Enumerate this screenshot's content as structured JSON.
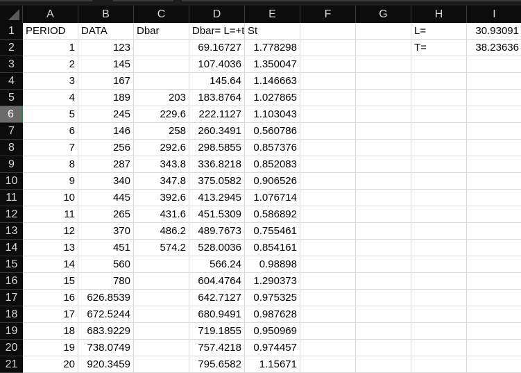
{
  "columns": [
    "A",
    "B",
    "C",
    "D",
    "E",
    "F",
    "G",
    "H",
    "I"
  ],
  "selected_row": 6,
  "colors": {
    "header_bg": "#0c0c0c",
    "selected_header_bg": "#6b6b6b",
    "selection_accent": "#1e8c4e",
    "gridline": "#d9d9d9"
  },
  "rows": [
    [
      "PERIOD",
      "DATA",
      "Dbar",
      "Dbar= L=+t",
      "St",
      "",
      "",
      "L=",
      "30.93091"
    ],
    [
      "1",
      "123",
      "",
      "69.16727",
      "1.778298",
      "",
      "",
      "T=",
      "38.23636"
    ],
    [
      "2",
      "145",
      "",
      "107.4036",
      "1.350047",
      "",
      "",
      "",
      ""
    ],
    [
      "3",
      "167",
      "",
      "145.64",
      "1.146663",
      "",
      "",
      "",
      ""
    ],
    [
      "4",
      "189",
      "203",
      "183.8764",
      "1.027865",
      "",
      "",
      "",
      ""
    ],
    [
      "5",
      "245",
      "229.6",
      "222.1127",
      "1.103043",
      "",
      "",
      "",
      ""
    ],
    [
      "6",
      "146",
      "258",
      "260.3491",
      "0.560786",
      "",
      "",
      "",
      ""
    ],
    [
      "7",
      "256",
      "292.6",
      "298.5855",
      "0.857376",
      "",
      "",
      "",
      ""
    ],
    [
      "8",
      "287",
      "343.8",
      "336.8218",
      "0.852083",
      "",
      "",
      "",
      ""
    ],
    [
      "9",
      "340",
      "347.8",
      "375.0582",
      "0.906526",
      "",
      "",
      "",
      ""
    ],
    [
      "10",
      "445",
      "392.6",
      "413.2945",
      "1.076714",
      "",
      "",
      "",
      ""
    ],
    [
      "11",
      "265",
      "431.6",
      "451.5309",
      "0.586892",
      "",
      "",
      "",
      ""
    ],
    [
      "12",
      "370",
      "486.2",
      "489.7673",
      "0.755461",
      "",
      "",
      "",
      ""
    ],
    [
      "13",
      "451",
      "574.2",
      "528.0036",
      "0.854161",
      "",
      "",
      "",
      ""
    ],
    [
      "14",
      "560",
      "",
      "566.24",
      "0.98898",
      "",
      "",
      "",
      ""
    ],
    [
      "15",
      "780",
      "",
      "604.4764",
      "1.290373",
      "",
      "",
      "",
      ""
    ],
    [
      "16",
      "626.8539",
      "",
      "642.7127",
      "0.975325",
      "",
      "",
      "",
      ""
    ],
    [
      "17",
      "672.5244",
      "",
      "680.9491",
      "0.987628",
      "",
      "",
      "",
      ""
    ],
    [
      "18",
      "683.9229",
      "",
      "719.1855",
      "0.950969",
      "",
      "",
      "",
      ""
    ],
    [
      "19",
      "738.0749",
      "",
      "757.4218",
      "0.974457",
      "",
      "",
      "",
      ""
    ],
    [
      "20",
      "920.3459",
      "",
      "795.6582",
      "1.15671",
      "",
      "",
      "",
      ""
    ]
  ]
}
